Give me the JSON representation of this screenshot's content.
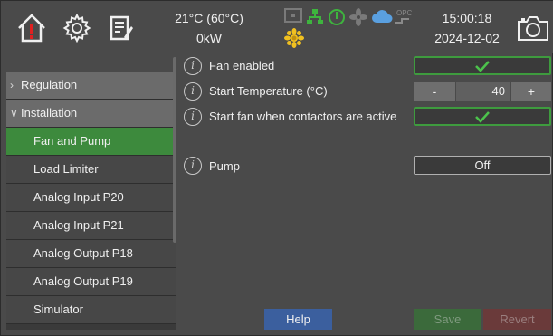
{
  "header": {
    "temperature": "21°C (60°C)",
    "power": "0kW",
    "time": "15:00:18",
    "date": "2024-12-02",
    "icons": [
      "home-alarm-icon",
      "gear-icon",
      "notes-icon",
      "camera-icon"
    ],
    "status_icons": [
      "meter-icon",
      "network-icon",
      "power-icon",
      "fan-icon",
      "cloud-icon",
      "opc-icon",
      "sun-icon"
    ],
    "status_icon_labels": {
      "opc": "OPC"
    }
  },
  "sidebar": {
    "items": [
      {
        "label": "Regulation",
        "type": "header",
        "expanded": false
      },
      {
        "label": "Installation",
        "type": "header",
        "expanded": true
      },
      {
        "label": "Fan and Pump",
        "type": "sub",
        "active": true
      },
      {
        "label": "Load Limiter",
        "type": "sub"
      },
      {
        "label": "Analog Input P20",
        "type": "sub"
      },
      {
        "label": "Analog Input P21",
        "type": "sub"
      },
      {
        "label": "Analog Output P18",
        "type": "sub"
      },
      {
        "label": "Analog Output P19",
        "type": "sub"
      },
      {
        "label": "Simulator",
        "type": "sub"
      }
    ]
  },
  "settings": {
    "fan_enabled": {
      "label": "Fan enabled",
      "checked": true
    },
    "start_temperature": {
      "label": "Start Temperature (°C)",
      "value": "40",
      "minus": "-",
      "plus": "+"
    },
    "start_with_contactors": {
      "label": "Start fan when contactors are active",
      "checked": true
    },
    "pump": {
      "label": "Pump",
      "value": "Off"
    },
    "info_glyph": "i"
  },
  "buttons": {
    "help": "Help",
    "save": "Save",
    "revert": "Revert"
  },
  "colors": {
    "background": "#4a4a4a",
    "active_green": "#3d8a3d",
    "checkbox_border": "#3e9b3e",
    "help_blue": "#3b5f9e",
    "revert_red": "#6a3a3a"
  }
}
